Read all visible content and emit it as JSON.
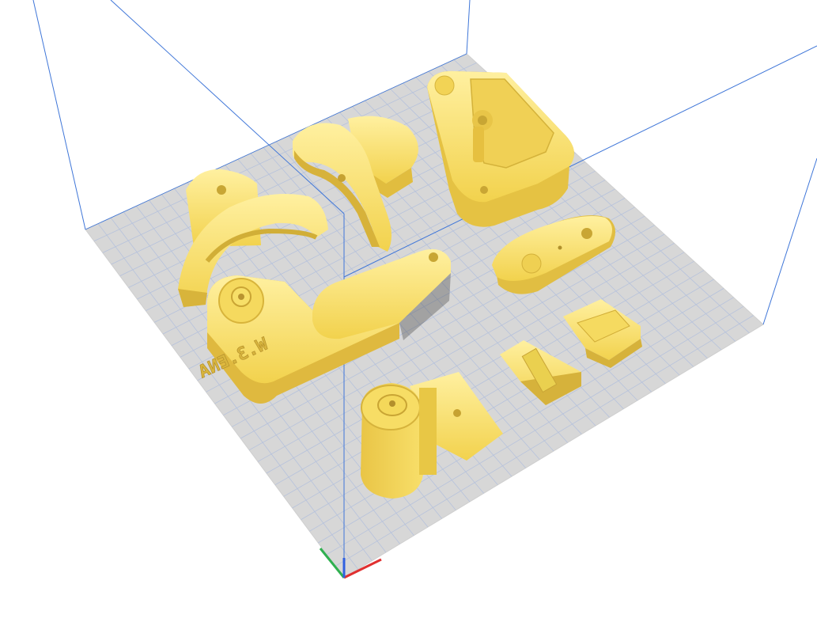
{
  "viewport": {
    "background": "#ffffff",
    "build_plate_color": "#d7d7d7",
    "grid_line_color": "#b6c2dc",
    "build_volume_line_color": "#3f76d8"
  },
  "model": {
    "color": "#f8df6a",
    "shadow_color": "#d9b93b",
    "highlight_color": "#fff2a0",
    "engraved_text": "W.3.ENA"
  },
  "axes": {
    "x_color": "#e03030",
    "y_color": "#30b050",
    "z_color": "#3060e0"
  },
  "icons": [
    "axis-gizmo-icon"
  ]
}
